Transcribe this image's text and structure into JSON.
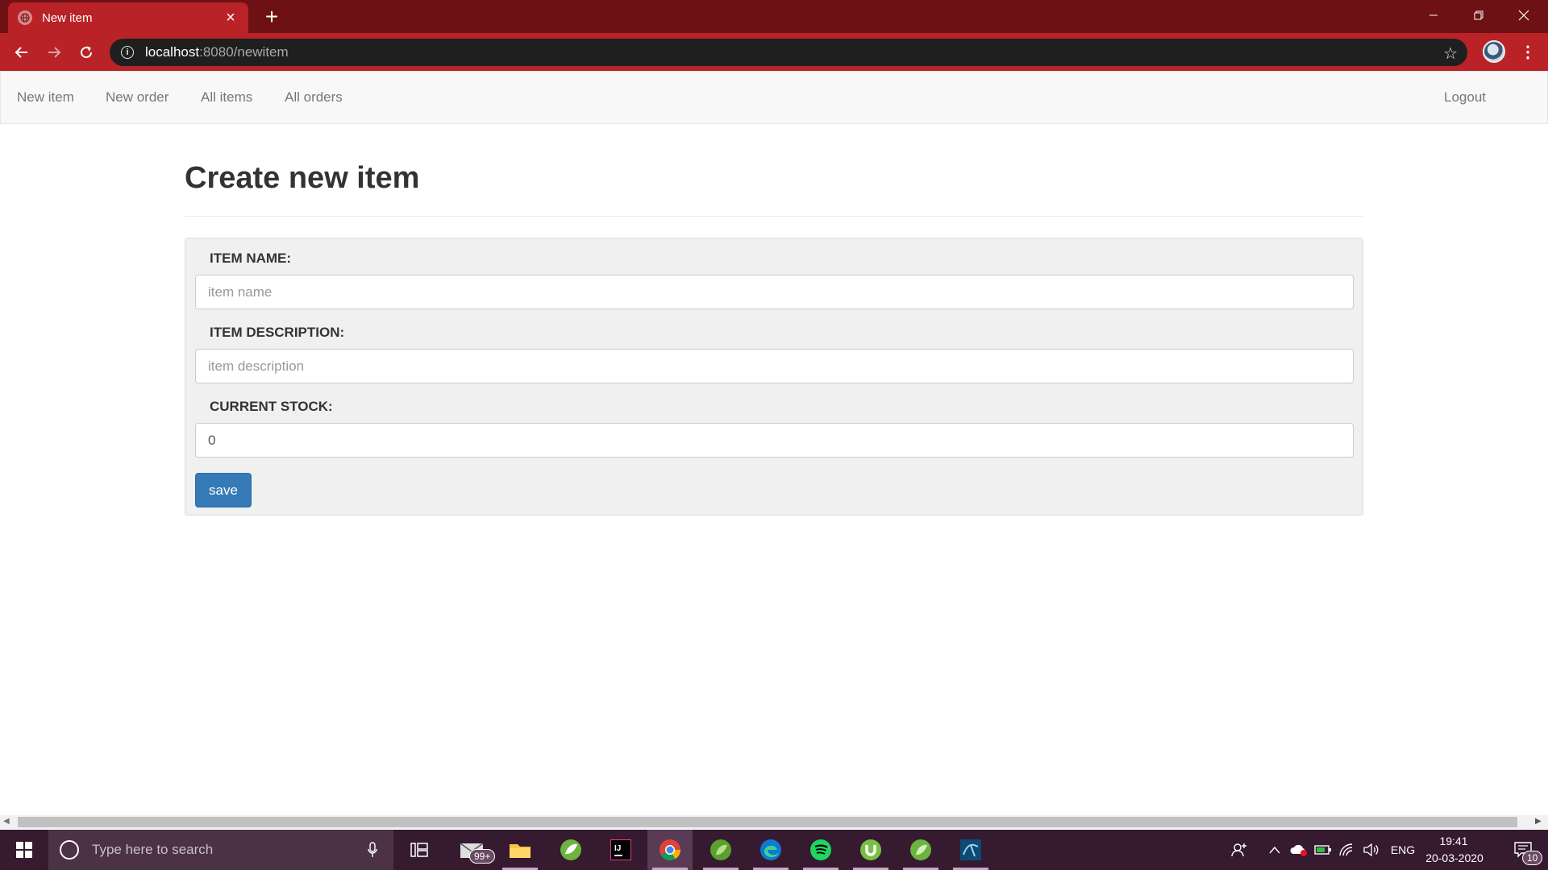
{
  "browser": {
    "tab_title": "New item",
    "tab_close": "×",
    "new_tab": "+",
    "url_host": "localhost",
    "url_rest": ":8080/newitem",
    "colors": {
      "frame": "#6e1114",
      "toolbar": "#b92226",
      "omnibox": "#1f1f1f"
    }
  },
  "navbar": {
    "links": [
      "New item",
      "New order",
      "All items",
      "All orders"
    ],
    "logout": "Logout"
  },
  "page": {
    "title": "Create new item"
  },
  "form": {
    "item_name_label": "ITEM NAME:",
    "item_name_placeholder": "item name",
    "item_name_value": "",
    "item_description_label": "ITEM DESCRIPTION:",
    "item_description_placeholder": "item description",
    "item_description_value": "",
    "current_stock_label": "CURRENT STOCK:",
    "current_stock_value": "0",
    "save_label": "save",
    "save_color": "#337ab7"
  },
  "taskbar": {
    "search_placeholder": "Type here to search",
    "mail_badge": "99+",
    "language": "ENG",
    "time": "19:41",
    "date": "20-03-2020",
    "notifications_badge": "10",
    "apps": [
      "task-view-icon",
      "mail-icon",
      "file-explorer-icon",
      "spring-tool-icon",
      "intellij-icon",
      "chrome-icon",
      "spring-boot-icon",
      "edge-icon",
      "spotify-icon",
      "utorrent-icon",
      "spring-icon",
      "mysql-workbench-icon"
    ]
  }
}
